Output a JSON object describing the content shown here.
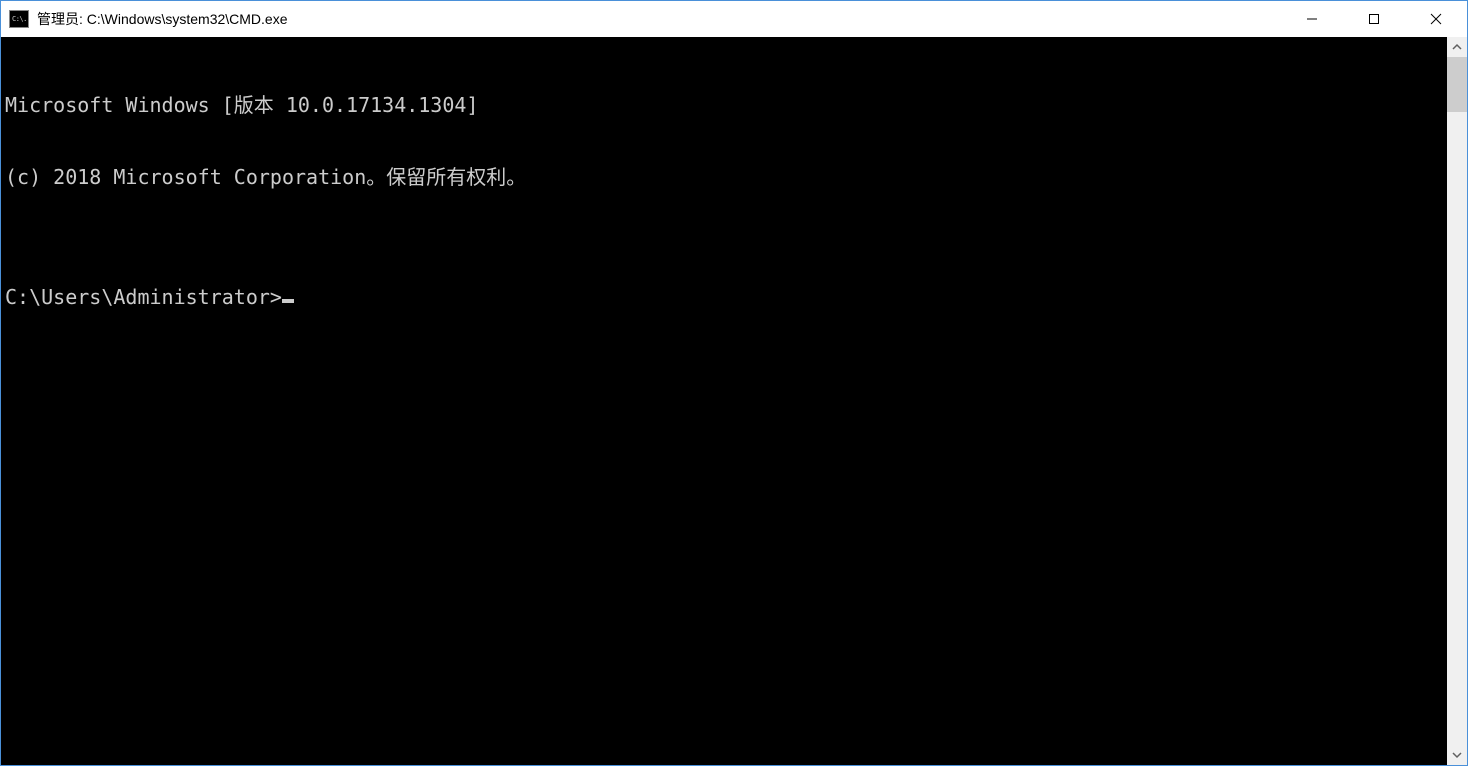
{
  "titlebar": {
    "icon_text": "C:\\.",
    "title": "管理员: C:\\Windows\\system32\\CMD.exe"
  },
  "terminal": {
    "line1": "Microsoft Windows [版本 10.0.17134.1304]",
    "line2": "(c) 2018 Microsoft Corporation。保留所有权利。",
    "blank": "",
    "prompt": "C:\\Users\\Administrator>"
  }
}
